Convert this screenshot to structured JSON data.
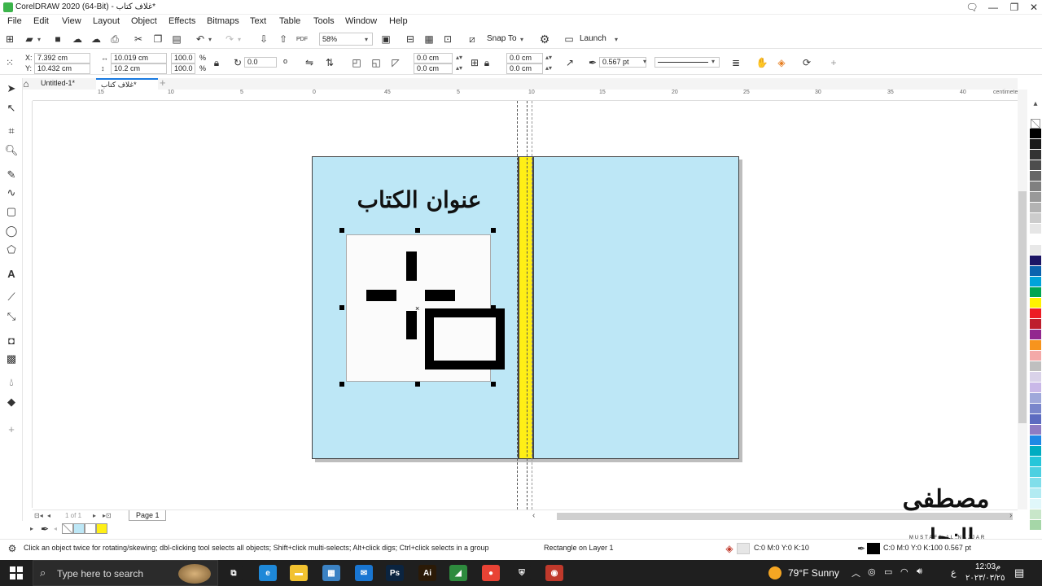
{
  "window": {
    "title": "CorelDRAW 2020 (64-Bit) - غلاف كتاب*",
    "controls": [
      "🗨",
      "—",
      "❐",
      "✕"
    ]
  },
  "menu": [
    "File",
    "Edit",
    "View",
    "Layout",
    "Object",
    "Effects",
    "Bitmaps",
    "Text",
    "Table",
    "Tools",
    "Window",
    "Help"
  ],
  "standard_toolbar": {
    "zoom": "58%",
    "snap_to": "Snap To",
    "launch": "Launch"
  },
  "property_bar": {
    "x_label": "X:",
    "x_value": "7.392 cm",
    "y_label": "Y:",
    "y_value": "10.432 cm",
    "width_value": "10.019 cm",
    "height_value": "10.2 cm",
    "scale_w": "100.0",
    "scale_h": "100.0",
    "percent": "%",
    "rotation": "0.0",
    "degree": "o",
    "corner_1": "0.0 cm",
    "corner_2": "0.0 cm",
    "corner_3": "0.0 cm",
    "corner_4": "0.0 cm",
    "outline_width": "0.567 pt"
  },
  "tabs": [
    {
      "label": "Untitled-1*"
    },
    {
      "label": "غلاف كتاب*"
    }
  ],
  "ruler": {
    "labels": [
      "15",
      "10",
      "5",
      "0",
      "5",
      "10",
      "15",
      "20",
      "25",
      "30",
      "35",
      "40",
      "45"
    ],
    "unit": "centimeters"
  },
  "document": {
    "heading": "عنوان الكتاب",
    "cover_color": "#bde7f6",
    "spine_color": "#ffef16"
  },
  "page_nav": {
    "counter": "1 of 1",
    "page_tab": "Page 1"
  },
  "status": {
    "hint": "Click an object twice for rotating/skewing; dbl-clicking tool selects all objects; Shift+click multi-selects; Alt+click digs; Ctrl+click selects in a group",
    "object_info": "Rectangle on Layer 1",
    "fill_info": "C:0 M:0 Y:0 K:10",
    "outline_info": "C:0 M:0 Y:0 K:100  0.567 pt"
  },
  "watermark": {
    "arabic": "مصطفى النجار",
    "latin": "MUSTAFA AL NAJJAR"
  },
  "taskbar": {
    "search_placeholder": "Type here to search",
    "weather": "79°F  Sunny",
    "time": "12:03",
    "ampm": "م",
    "date": "٢٠٢٣/٠٣/٢٥",
    "lang": "ع",
    "apps": [
      {
        "name": "task-view",
        "label": "⧉",
        "color": "#1f1f1f"
      },
      {
        "name": "edge",
        "label": "e",
        "color": "#1e88d8"
      },
      {
        "name": "explorer",
        "label": "▬",
        "color": "#f2c230"
      },
      {
        "name": "store",
        "label": "▦",
        "color": "#3b82c4"
      },
      {
        "name": "mail",
        "label": "✉",
        "color": "#1976d2"
      },
      {
        "name": "photoshop",
        "label": "Ps",
        "color": "#0b2440"
      },
      {
        "name": "illustrator",
        "label": "Ai",
        "color": "#2b1a07"
      },
      {
        "name": "coreldraw",
        "label": "◢",
        "color": "#2e8b3e"
      },
      {
        "name": "chrome",
        "label": "●",
        "color": "#e94335"
      },
      {
        "name": "security",
        "label": "⛨",
        "color": "#1f1f1f"
      },
      {
        "name": "recorder",
        "label": "◉",
        "color": "#c0392b"
      }
    ]
  },
  "palette": [
    "#ffffff",
    "#000000",
    "#1a1a1a",
    "#333333",
    "#4d4d4d",
    "#666666",
    "#808080",
    "#999999",
    "#b3b3b3",
    "#cccccc",
    "#e6e6e6",
    "#ffffff",
    "#e8e8e8",
    "#1b1464",
    "#0b63ae",
    "#00a3d9",
    "#00a651",
    "#fff200",
    "#ed1c24",
    "#be1e2d",
    "#92278f",
    "#f7941d",
    "#f4a9a8",
    "#bfbfbf",
    "#d9d2e9",
    "#c9b8e8",
    "#9fa8da",
    "#7986cb",
    "#5c6bc0",
    "#8e7cc3",
    "#1e88e5",
    "#00acc1",
    "#26c6da",
    "#4dd0e1",
    "#80deea",
    "#b2ebf2",
    "#e0f7fa",
    "#c8e6c9",
    "#a5d6a7"
  ]
}
